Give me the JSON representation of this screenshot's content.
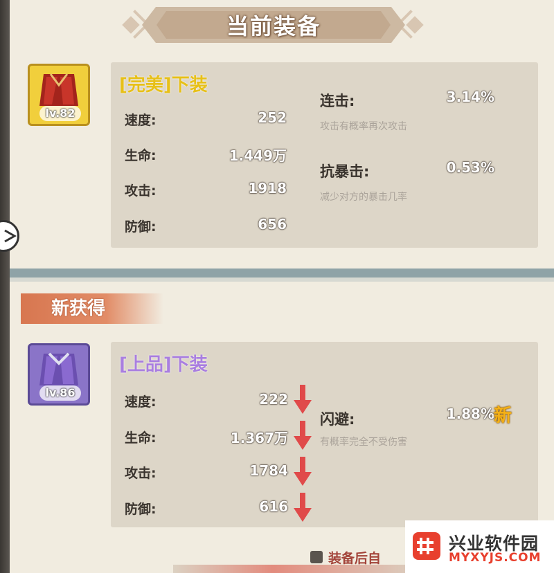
{
  "header": {
    "title": "当前装备"
  },
  "current_item": {
    "name": "[完美]下装",
    "level": "lv.82",
    "stats": [
      {
        "label": "速度:",
        "value": "252"
      },
      {
        "label": "生命:",
        "value": "1.449万"
      },
      {
        "label": "攻击:",
        "value": "1918"
      },
      {
        "label": "防御:",
        "value": "656"
      }
    ],
    "special": [
      {
        "label": "连击:",
        "value": "3.14%",
        "desc": "攻击有概率再次攻击"
      },
      {
        "label": "抗暴击:",
        "value": "0.53%",
        "desc": "减少对方的暴击几率"
      }
    ]
  },
  "new_section": {
    "title": "新获得"
  },
  "new_item": {
    "name": "[上品]下装",
    "level": "lv.86",
    "stats": [
      {
        "label": "速度:",
        "value": "222",
        "trend": "down"
      },
      {
        "label": "生命:",
        "value": "1.367万",
        "trend": "down"
      },
      {
        "label": "攻击:",
        "value": "1784",
        "trend": "down"
      },
      {
        "label": "防御:",
        "value": "616",
        "trend": "down"
      }
    ],
    "special": [
      {
        "label": "闪避:",
        "value": "1.88%",
        "desc": "有概率完全不受伤害",
        "badge": "新"
      }
    ]
  },
  "footer": {
    "auto_text": "装备后自"
  },
  "watermark": {
    "title": "兴业软件园",
    "url": "MYXYJS.COM"
  },
  "colors": {
    "gold": "#e7c018",
    "purple": "#a97ee0",
    "arrow_red": "#e04a4a",
    "panel_bg": "#f1ece0"
  }
}
